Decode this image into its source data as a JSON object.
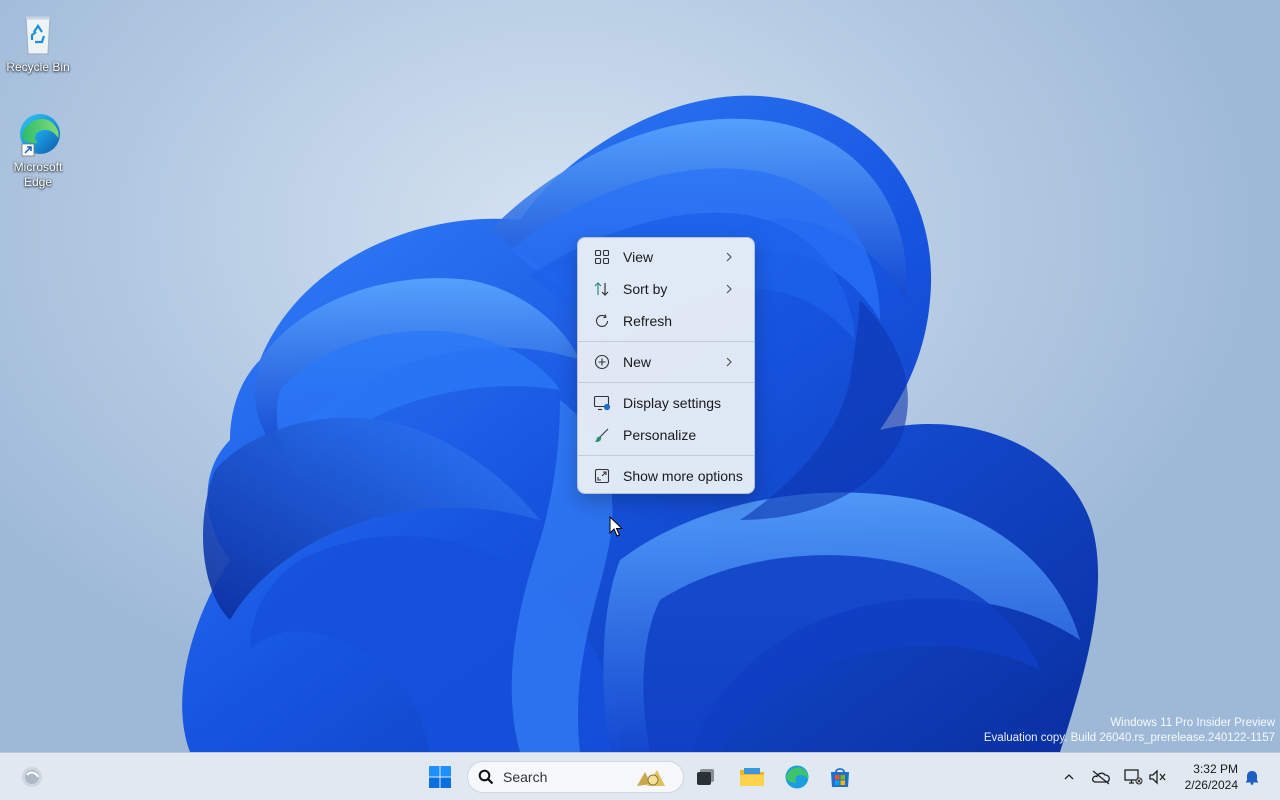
{
  "desktop": {
    "icons": [
      {
        "label": "Recycle Bin",
        "icon": "recycle-bin-icon"
      },
      {
        "label": "Microsoft Edge",
        "icon": "edge-icon"
      }
    ],
    "watermark": {
      "line1": "Windows 11 Pro Insider Preview",
      "line2": "Evaluation copy. Build 26040.rs_prerelease.240122-1157"
    }
  },
  "context_menu": {
    "items": [
      {
        "label": "View",
        "icon": "grid-icon",
        "submenu": true
      },
      {
        "label": "Sort by",
        "icon": "sort-icon",
        "submenu": true
      },
      {
        "label": "Refresh",
        "icon": "refresh-icon",
        "submenu": false
      },
      {
        "label": "New",
        "icon": "plus-circle-icon",
        "submenu": true
      },
      {
        "label": "Display settings",
        "icon": "display-settings-icon",
        "submenu": false
      },
      {
        "label": "Personalize",
        "icon": "brush-icon",
        "submenu": false
      },
      {
        "label": "Show more options",
        "icon": "expand-icon",
        "submenu": false
      }
    ]
  },
  "taskbar": {
    "search_label": "Search",
    "pinned": [
      "start-icon",
      "search-icon",
      "task-view-icon",
      "file-explorer-icon",
      "edge-icon",
      "store-icon"
    ],
    "clock": {
      "time": "3:32 PM",
      "date": "2/26/2024"
    }
  },
  "colors": {
    "accent": "#0067c0",
    "wallpaper_bloom": "#1a5ce8"
  }
}
